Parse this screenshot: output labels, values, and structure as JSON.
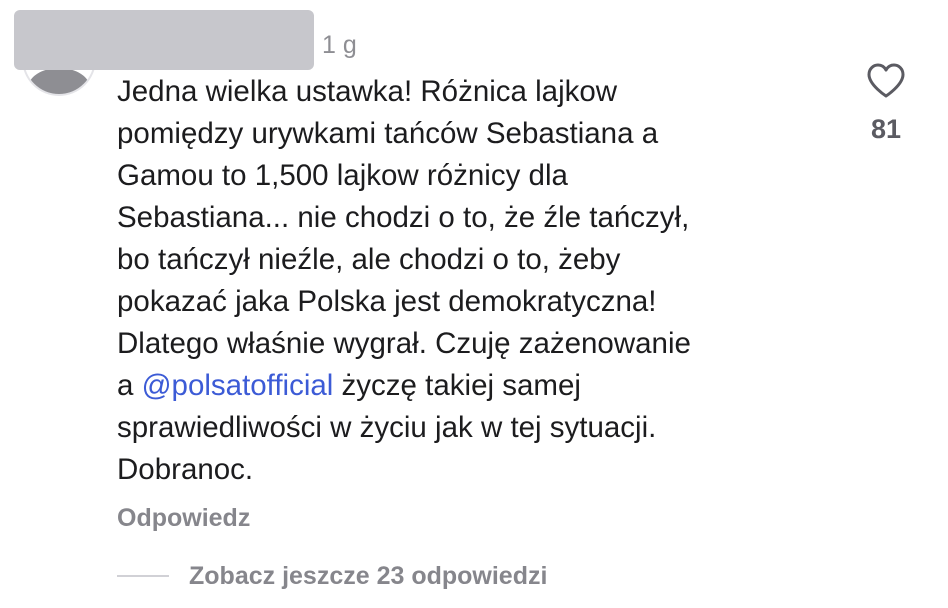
{
  "comment": {
    "timestamp": "1 g",
    "lines": [
      "Jedna wielka ustawka! Różnica lajkow",
      "pomiędzy urywkami tańców Sebastiana a",
      "Gamou to 1,500 lajkow różnicy dla",
      "Sebastiana... nie chodzi o to, że źle tańczył,",
      "bo tańczył nieźle, ale chodzi o to, żeby",
      "pokazać jaka Polska jest demokratyczna!",
      "Dlatego właśnie wygrał. Czuję zażenowanie"
    ],
    "mention_prefix": "a ",
    "mention": "@polsatofficial",
    "mention_suffix": " życzę takiej samej",
    "lines_after": [
      "sprawiedliwości w życiu jak w tej sytuacji.",
      "Dobranoc."
    ],
    "like_count": "81",
    "reply_label": "Odpowiedz",
    "view_replies_label": "Zobacz jeszcze 23 odpowiedzi"
  },
  "colors": {
    "mention": "#3c5bd6",
    "secondary_text": "#86868c",
    "redaction": "#c7c7cc"
  },
  "icons": {
    "like": "heart-outline-icon",
    "avatar": "default-avatar-icon"
  }
}
